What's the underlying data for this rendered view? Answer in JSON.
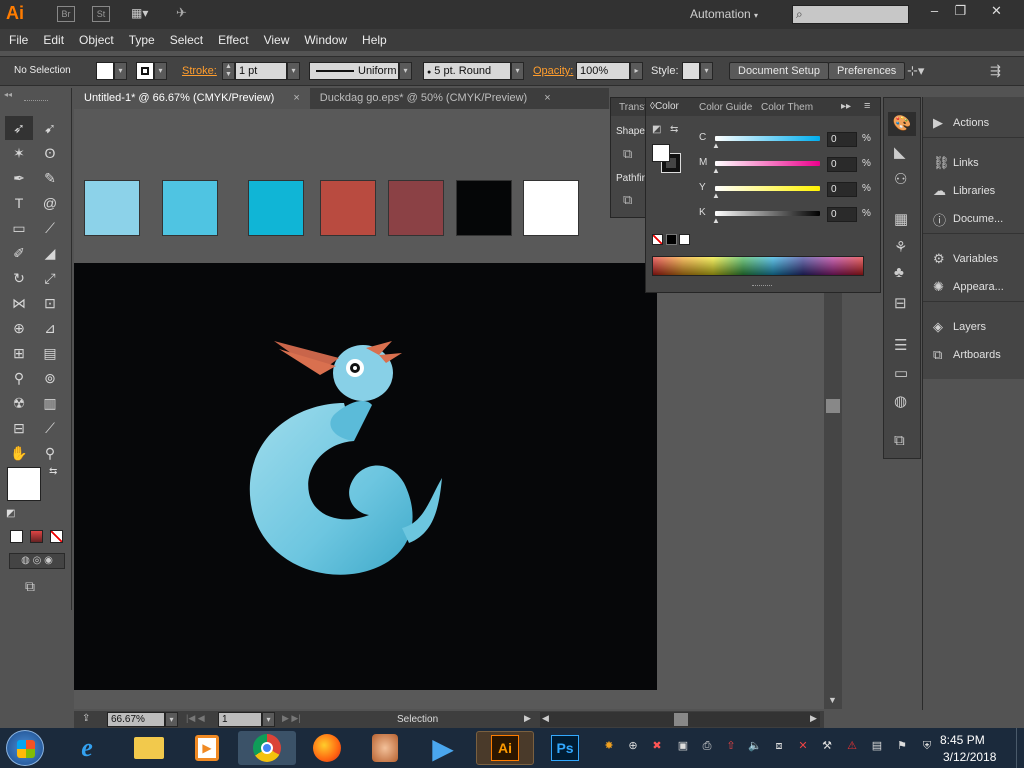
{
  "app": {
    "logo": "Ai",
    "bridge_icon": "Br",
    "stock_icon": "St",
    "workspace": "Automation",
    "window_buttons": [
      "–",
      "❐",
      "✕"
    ]
  },
  "menu": [
    "File",
    "Edit",
    "Object",
    "Type",
    "Select",
    "Effect",
    "View",
    "Window",
    "Help"
  ],
  "control": {
    "selection": "No Selection",
    "stroke_label": "Stroke:",
    "stroke_weight": "1 pt",
    "profile": "Uniform",
    "brush": "5 pt. Round",
    "opacity_label": "Opacity:",
    "opacity": "100%",
    "style_label": "Style:",
    "document_setup": "Document Setup",
    "preferences": "Preferences"
  },
  "tabs": [
    {
      "title": "Untitled-1* @ 66.67% (CMYK/Preview)",
      "close": "×"
    },
    {
      "title": "Duckdag go.eps* @ 50% (CMYK/Preview)",
      "close": "×"
    }
  ],
  "swatches": [
    "#8cd2e9",
    "#4fc4e2",
    "#10b5d6",
    "#b94b40",
    "#8b4145",
    "#050607",
    "#ffffff"
  ],
  "color_panel": {
    "tabs": [
      "Color",
      "Color Guide",
      "Color Them"
    ],
    "channels": [
      {
        "label": "C",
        "value": "0"
      },
      {
        "label": "M",
        "value": "0"
      },
      {
        "label": "Y",
        "value": "0"
      },
      {
        "label": "K",
        "value": "0"
      }
    ],
    "percent": "%"
  },
  "transform_panel": {
    "tab": "Transf",
    "shape": "Shape",
    "pathfinder": "Pathfir"
  },
  "right_dock": [
    {
      "label": "Actions",
      "icon": "play-icon"
    },
    {
      "label": "Links",
      "icon": "link-icon"
    },
    {
      "label": "Libraries",
      "icon": "cloud-icon"
    },
    {
      "label": "Docume...",
      "icon": "document-icon"
    },
    {
      "label": "Variables",
      "icon": "variables-icon"
    },
    {
      "label": "Appeara...",
      "icon": "appearance-icon"
    },
    {
      "label": "Layers",
      "icon": "layers-icon"
    },
    {
      "label": "Artboards",
      "icon": "artboards-icon"
    }
  ],
  "status": {
    "zoom": "66.67%",
    "artboard": "1",
    "tool": "Selection"
  },
  "taskbar": {
    "time": "8:45 PM",
    "date": "3/12/2018",
    "ai": "Ai",
    "ps": "Ps"
  },
  "colors": {
    "accent": "#ff7c00",
    "canvas_dark": "#060709",
    "duck_body": "#7ccde6",
    "beak": "#d9704f"
  }
}
